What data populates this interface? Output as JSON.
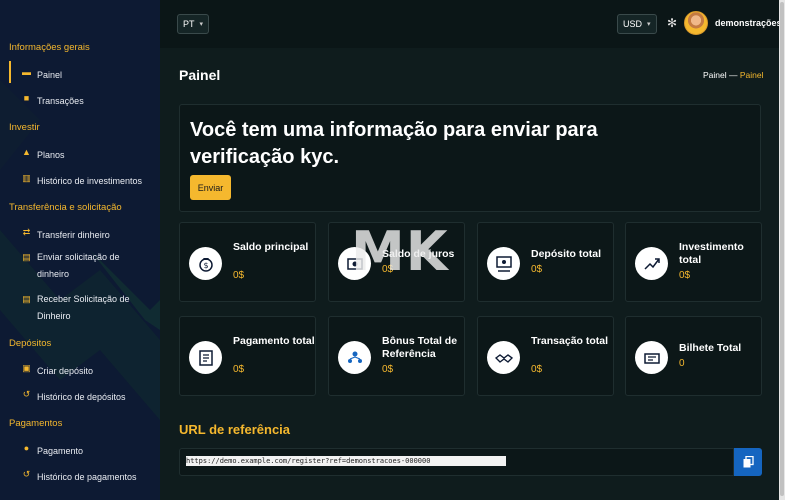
{
  "topbar": {
    "language": "PT",
    "currency": "USD",
    "username": "demonstrações"
  },
  "sidebar": {
    "sections": [
      {
        "title": "Informações gerais",
        "items": [
          {
            "label": "Painel",
            "icon": "dashboard-icon",
            "active": true
          },
          {
            "label": "Transações",
            "icon": "briefcase-icon"
          }
        ]
      },
      {
        "title": "Investir",
        "items": [
          {
            "label": "Planos",
            "icon": "bell-icon"
          },
          {
            "label": "Histórico de investimentos",
            "icon": "chart-icon"
          }
        ]
      },
      {
        "title": "Transferência e solicitação",
        "items": [
          {
            "label": "Transferir dinheiro",
            "icon": "swap-icon"
          },
          {
            "label": "Enviar solicitação de dinheiro",
            "icon": "send-icon"
          },
          {
            "label": "Receber Solicitação de Dinheiro",
            "icon": "receive-icon"
          }
        ]
      },
      {
        "title": "Depósitos",
        "items": [
          {
            "label": "Criar depósito",
            "icon": "wallet-icon"
          },
          {
            "label": "Histórico de depósitos",
            "icon": "history-icon"
          }
        ]
      },
      {
        "title": "Pagamentos",
        "items": [
          {
            "label": "Pagamento",
            "icon": "user-pay-icon"
          },
          {
            "label": "Histórico de pagamentos",
            "icon": "history-icon"
          }
        ]
      }
    ]
  },
  "page": {
    "title": "Painel",
    "breadcrumb": {
      "home": "Painel",
      "separator": "—",
      "current": "Painel"
    }
  },
  "kyc": {
    "message": "Você tem uma informação para enviar para verificação kyc.",
    "button": "Enviar"
  },
  "stats": [
    {
      "title": "Saldo principal",
      "value": "0$",
      "icon": "money-bag-icon"
    },
    {
      "title": "Saldo de juros",
      "value": "0$",
      "icon": "cash-icon"
    },
    {
      "title": "Depósito total",
      "value": "0$",
      "icon": "deposit-icon"
    },
    {
      "title": "Investimento total",
      "value": "0$",
      "icon": "investment-icon"
    },
    {
      "title": "Pagamento total",
      "value": "0$",
      "icon": "payment-icon"
    },
    {
      "title": "Bônus Total de Referência",
      "value": "0$",
      "icon": "referral-icon"
    },
    {
      "title": "Transação total",
      "value": "0$",
      "icon": "handshake-icon"
    },
    {
      "title": "Bilhete Total",
      "value": "0",
      "icon": "ticket-icon"
    }
  ],
  "watermark": "MK",
  "referral": {
    "title": "URL de referência",
    "url": "https://demo.example.com/register?ref=demonstracoes-000000"
  },
  "colors": {
    "accent": "#f5b82e",
    "sidebar_bg": "#0d1a33",
    "main_bg": "#0f1c1d",
    "copy_button": "#1565c0"
  }
}
